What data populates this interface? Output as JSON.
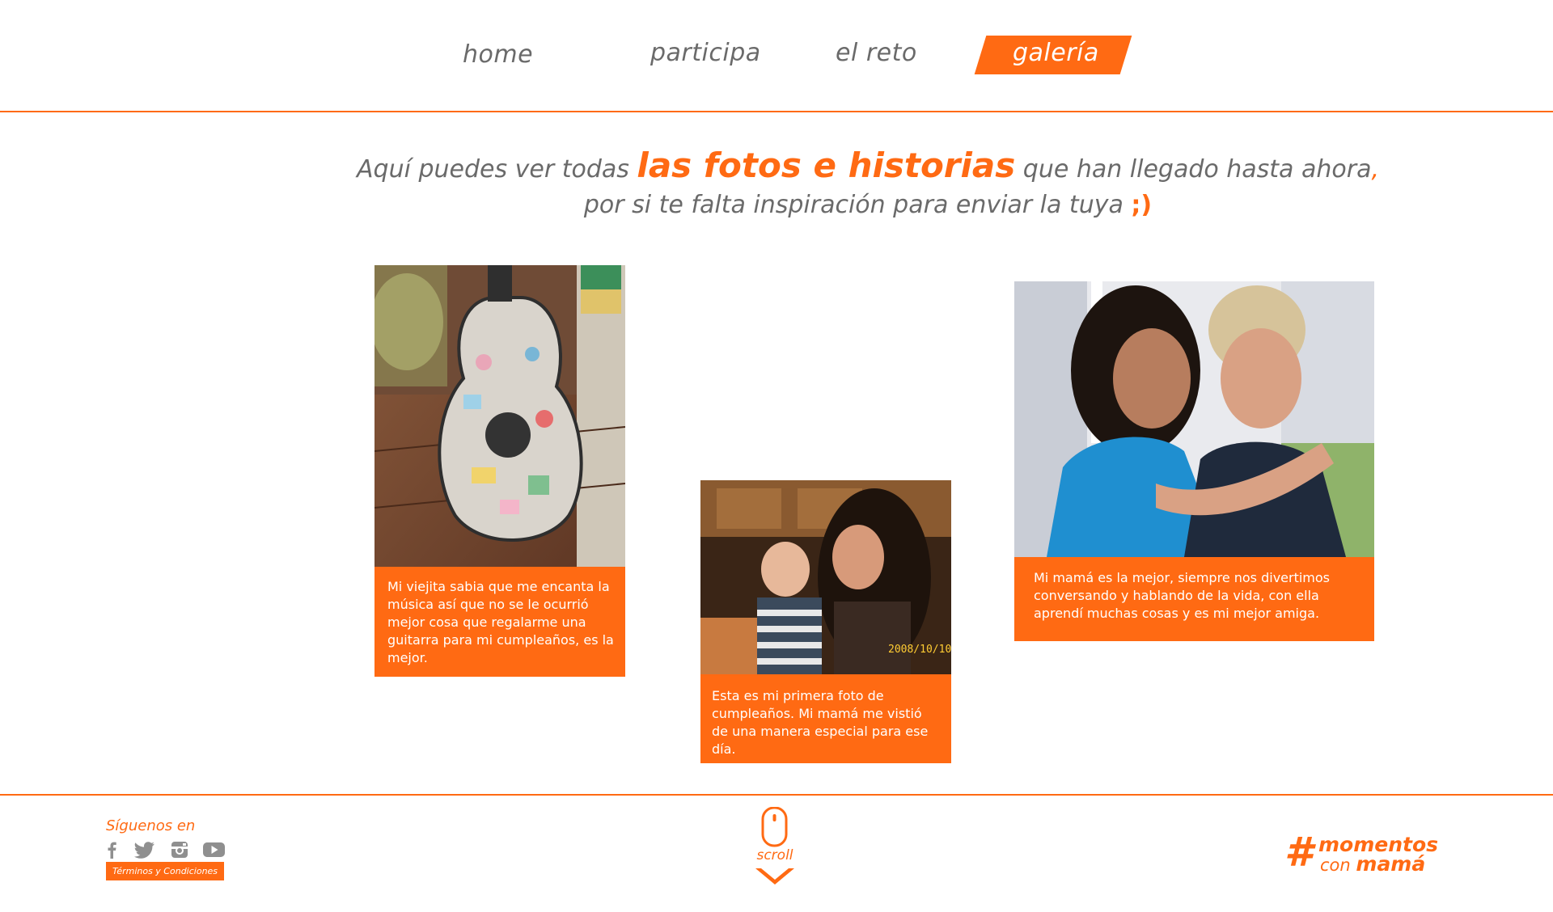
{
  "nav": {
    "items": [
      {
        "label": "home"
      },
      {
        "label": "participa"
      },
      {
        "label": "el reto"
      },
      {
        "label": "galería",
        "active": true
      }
    ]
  },
  "intro": {
    "line1_pre": "Aquí puedes ver todas ",
    "line1_highlight": "las fotos e historias",
    "line1_post": " que han llegado hasta ahora",
    "line1_comma": ",",
    "line2": "por si te falta inspiración para enviar la tuya ",
    "line2_wink": ";)"
  },
  "gallery": [
    {
      "caption": "Mi viejita sabia que me encanta la música así que no se le ocurrió mejor cosa que regalarme una guitarra para mi cumpleaños, es la mejor."
    },
    {
      "caption": "Esta es mi primera foto de cumpleaños. Mi mamá me vistió de una manera especial para ese día.",
      "datestamp": "2008/10/10"
    },
    {
      "caption": "Mi mamá es la mejor, siempre nos divertimos conversando y hablando de la vida, con ella aprendí muchas cosas y es mi mejor amiga."
    }
  ],
  "footer": {
    "follow_label": "Síguenos en",
    "social_icons": [
      "facebook-icon",
      "twitter-icon",
      "instagram-icon",
      "youtube-icon"
    ],
    "terms_label": "Términos y Condiciones",
    "scroll_label": "scroll",
    "brand": {
      "hash": "#",
      "line1": "momentos",
      "line2_pre": "con ",
      "line2_bold": "mamá"
    }
  },
  "colors": {
    "accent": "#ff6a13",
    "text": "#6a6a6a",
    "background": "#ffffff"
  }
}
